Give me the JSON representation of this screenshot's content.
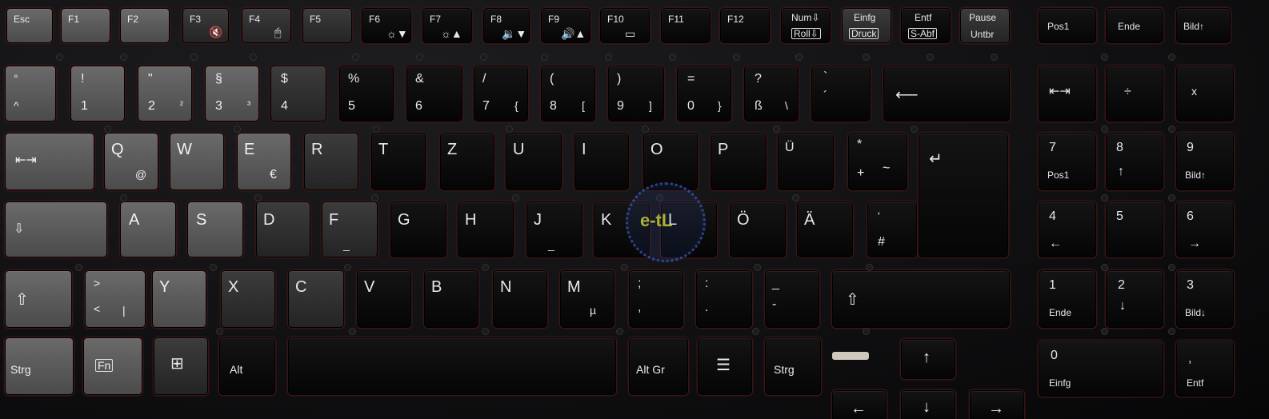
{
  "rows": {
    "function": [
      {
        "id": "esc",
        "labels": [
          "Esc"
        ]
      },
      {
        "id": "f1",
        "labels": [
          "F1"
        ]
      },
      {
        "id": "f2",
        "labels": [
          "F2"
        ]
      },
      {
        "id": "f3",
        "labels": [
          "F3",
          "🔇"
        ]
      },
      {
        "id": "f4",
        "labels": [
          "F4",
          "🖱"
        ]
      },
      {
        "id": "f5",
        "labels": [
          "F5"
        ]
      },
      {
        "id": "f6",
        "labels": [
          "F6",
          "☼▼"
        ]
      },
      {
        "id": "f7",
        "labels": [
          "F7",
          "☼▲"
        ]
      },
      {
        "id": "f8",
        "labels": [
          "F8",
          "🔉▼"
        ]
      },
      {
        "id": "f9",
        "labels": [
          "F9",
          "🔊▲"
        ]
      },
      {
        "id": "f10",
        "labels": [
          "F10",
          "▭"
        ]
      },
      {
        "id": "f11",
        "labels": [
          "F11"
        ]
      },
      {
        "id": "f12",
        "labels": [
          "F12"
        ]
      },
      {
        "id": "num",
        "labels": [
          "Num⇩",
          "Roll⇩"
        ]
      },
      {
        "id": "einfg",
        "labels": [
          "Einfg",
          "Druck"
        ]
      },
      {
        "id": "entf",
        "labels": [
          "Entf",
          "S-Abf"
        ]
      },
      {
        "id": "pause",
        "labels": [
          "Pause",
          "Untbr"
        ]
      },
      {
        "id": "pos1",
        "labels": [
          "Pos1"
        ]
      },
      {
        "id": "ende",
        "labels": [
          "Ende"
        ]
      },
      {
        "id": "bild-up",
        "labels": [
          "Bild↑"
        ]
      }
    ],
    "number": [
      {
        "id": "circumflex",
        "labels": [
          "°",
          "^"
        ]
      },
      {
        "id": "1",
        "labels": [
          "!",
          "1"
        ]
      },
      {
        "id": "2",
        "labels": [
          "\"",
          "2",
          "²"
        ]
      },
      {
        "id": "3",
        "labels": [
          "§",
          "3",
          "³"
        ]
      },
      {
        "id": "4",
        "labels": [
          "$",
          "4"
        ]
      },
      {
        "id": "5",
        "labels": [
          "%",
          "5"
        ]
      },
      {
        "id": "6",
        "labels": [
          "&",
          "6"
        ]
      },
      {
        "id": "7",
        "labels": [
          "/",
          "7",
          "{"
        ]
      },
      {
        "id": "8",
        "labels": [
          "(",
          "8",
          "["
        ]
      },
      {
        "id": "9",
        "labels": [
          ")",
          "9",
          "]"
        ]
      },
      {
        "id": "0",
        "labels": [
          "=",
          "0",
          "}"
        ]
      },
      {
        "id": "sz",
        "labels": [
          "?",
          "ß",
          "\\"
        ]
      },
      {
        "id": "acute",
        "labels": [
          "`",
          "´"
        ]
      },
      {
        "id": "backspace",
        "labels": [
          "⟵"
        ]
      }
    ],
    "qwertz": [
      {
        "id": "tab",
        "labels": [
          "⇤⇥"
        ]
      },
      {
        "id": "q",
        "labels": [
          "Q",
          "@"
        ]
      },
      {
        "id": "w",
        "labels": [
          "W"
        ]
      },
      {
        "id": "e",
        "labels": [
          "E",
          "€"
        ]
      },
      {
        "id": "r",
        "labels": [
          "R"
        ]
      },
      {
        "id": "t",
        "labels": [
          "T"
        ]
      },
      {
        "id": "z",
        "labels": [
          "Z"
        ]
      },
      {
        "id": "u",
        "labels": [
          "U"
        ]
      },
      {
        "id": "i",
        "labels": [
          "I"
        ]
      },
      {
        "id": "o",
        "labels": [
          "O"
        ]
      },
      {
        "id": "p",
        "labels": [
          "P"
        ]
      },
      {
        "id": "ue",
        "labels": [
          "Ü"
        ]
      },
      {
        "id": "plus",
        "labels": [
          "*",
          "+",
          "~"
        ]
      },
      {
        "id": "enter",
        "labels": [
          "↵"
        ]
      }
    ],
    "home": [
      {
        "id": "caps",
        "labels": [
          "⇩"
        ]
      },
      {
        "id": "a",
        "labels": [
          "A"
        ]
      },
      {
        "id": "s",
        "labels": [
          "S"
        ]
      },
      {
        "id": "d",
        "labels": [
          "D"
        ]
      },
      {
        "id": "f",
        "labels": [
          "F",
          "_"
        ]
      },
      {
        "id": "g",
        "labels": [
          "G"
        ]
      },
      {
        "id": "h",
        "labels": [
          "H"
        ]
      },
      {
        "id": "j",
        "labels": [
          "J",
          "_"
        ]
      },
      {
        "id": "k",
        "labels": [
          "K"
        ]
      },
      {
        "id": "l",
        "labels": [
          "L"
        ]
      },
      {
        "id": "oe",
        "labels": [
          "Ö"
        ]
      },
      {
        "id": "ae",
        "labels": [
          "Ä"
        ]
      },
      {
        "id": "hash",
        "labels": [
          "'",
          "#"
        ]
      }
    ],
    "bottom": [
      {
        "id": "lshift",
        "labels": [
          "⇧"
        ]
      },
      {
        "id": "angle",
        "labels": [
          ">",
          "<",
          "|"
        ]
      },
      {
        "id": "y",
        "labels": [
          "Y"
        ]
      },
      {
        "id": "x",
        "labels": [
          "X"
        ]
      },
      {
        "id": "c",
        "labels": [
          "C"
        ]
      },
      {
        "id": "v",
        "labels": [
          "V"
        ]
      },
      {
        "id": "b",
        "labels": [
          "B"
        ]
      },
      {
        "id": "n",
        "labels": [
          "N"
        ]
      },
      {
        "id": "m",
        "labels": [
          "M",
          "µ"
        ]
      },
      {
        "id": "comma",
        "labels": [
          ";",
          ","
        ]
      },
      {
        "id": "period",
        "labels": [
          ":",
          "."
        ]
      },
      {
        "id": "minus",
        "labels": [
          "_",
          "-"
        ]
      },
      {
        "id": "rshift",
        "labels": [
          "⇧"
        ]
      }
    ],
    "space": [
      {
        "id": "strg-l",
        "labels": [
          "Strg"
        ]
      },
      {
        "id": "fn",
        "labels": [
          "Fn"
        ]
      },
      {
        "id": "win",
        "labels": [
          "⊞"
        ]
      },
      {
        "id": "alt",
        "labels": [
          "Alt"
        ]
      },
      {
        "id": "spacebar",
        "labels": []
      },
      {
        "id": "altgr",
        "labels": [
          "Alt Gr"
        ]
      },
      {
        "id": "menu",
        "labels": [
          "☰"
        ]
      },
      {
        "id": "strg-r",
        "labels": [
          "Strg"
        ]
      },
      {
        "id": "up",
        "labels": [
          "↑"
        ]
      }
    ],
    "numpad": [
      {
        "id": "np-tab",
        "labels": [
          "⇤⇥"
        ]
      },
      {
        "id": "np-div",
        "labels": [
          "÷"
        ]
      },
      {
        "id": "np-mul",
        "labels": [
          "x"
        ]
      },
      {
        "id": "np7",
        "labels": [
          "7",
          "Pos1"
        ]
      },
      {
        "id": "np8",
        "labels": [
          "8",
          "↑"
        ]
      },
      {
        "id": "np9",
        "labels": [
          "9",
          "Bild↑"
        ]
      },
      {
        "id": "np4",
        "labels": [
          "4",
          "←"
        ]
      },
      {
        "id": "np5",
        "labels": [
          "5"
        ]
      },
      {
        "id": "np6",
        "labels": [
          "6",
          "→"
        ]
      },
      {
        "id": "np1",
        "labels": [
          "1",
          "Ende"
        ]
      },
      {
        "id": "np2",
        "labels": [
          "2",
          "↓"
        ]
      },
      {
        "id": "np3",
        "labels": [
          "3",
          "Bild↓"
        ]
      },
      {
        "id": "np0",
        "labels": [
          "0",
          "Einfg"
        ]
      },
      {
        "id": "np-dec",
        "labels": [
          ",",
          "Entf"
        ]
      }
    ],
    "arrows_bottom": [
      {
        "id": "left",
        "labels": [
          "←"
        ]
      },
      {
        "id": "down",
        "labels": [
          "↓"
        ]
      },
      {
        "id": "right",
        "labels": [
          "→"
        ]
      }
    ]
  },
  "watermark": "e-tL",
  "key_colors": {
    "worn_grey": "#5a5a5a",
    "black": "#0e0e0f",
    "backlight_edge": "#3a1414"
  }
}
